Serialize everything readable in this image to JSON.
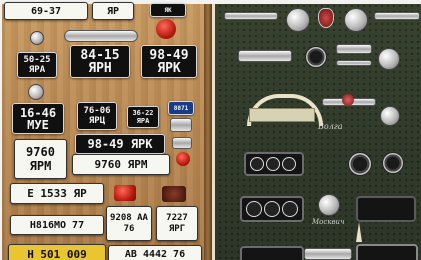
{
  "plates": {
    "top_left": "69-37",
    "top_mid": "ЯР",
    "p1": "84-15 ЯРН",
    "p2": "98-49 ЯРК",
    "p3": "50-25 ЯРА",
    "p4": "16-46 МУЕ",
    "p5": "76-06 ЯРЦ",
    "p6": "36-22 ЯРА",
    "p7": "8071",
    "p8": "9760 ЯРМ",
    "p9": "98-49 ЯРК",
    "p10": "9760 ЯРМ",
    "p11": "Е 1533 ЯР",
    "p12": "Н816МО 77",
    "p13": "9208 АА 76",
    "p14": "7227 ЯРГ",
    "p15": "Н 501 009",
    "p16": "АВ 4442 76",
    "p17": "ЯК"
  },
  "emblem_text": "Волга",
  "emblem_text_2": "Москвич"
}
